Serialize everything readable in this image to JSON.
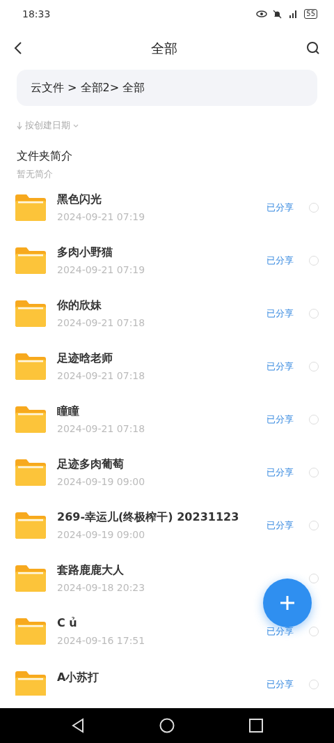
{
  "status_bar": {
    "time": "18:33",
    "battery": "55"
  },
  "header": {
    "title": "全部"
  },
  "breadcrumb": "云文件 > 全部2> 全部",
  "sort": {
    "label": "按创建日期"
  },
  "intro": {
    "title": "文件夹简介",
    "text": "暂无简介"
  },
  "folders": [
    {
      "name": "黑色闪光",
      "date": "2024-09-21 07:19",
      "share_status": "已分享",
      "selected": false
    },
    {
      "name": "多肉小野猫",
      "date": "2024-09-21 07:19",
      "share_status": "已分享",
      "selected": false
    },
    {
      "name": "你的欣妹",
      "date": "2024-09-21 07:18",
      "share_status": "已分享",
      "selected": false
    },
    {
      "name": "足迹晗老师",
      "date": "2024-09-21 07:18",
      "share_status": "已分享",
      "selected": false
    },
    {
      "name": "瞳瞳",
      "date": "2024-09-21 07:18",
      "share_status": "已分享",
      "selected": false
    },
    {
      "name": "足迹多肉葡萄",
      "date": "2024-09-19 09:00",
      "share_status": "已分享",
      "selected": false
    },
    {
      "name": "269-幸运儿(终极榨干) 20231123",
      "date": "2024-09-19 09:00",
      "share_status": "已分享",
      "selected": false
    },
    {
      "name": "套路鹿鹿大人",
      "date": "2024-09-18 20:23",
      "selected": false
    },
    {
      "name": "C ủ",
      "date": "2024-09-16 17:51",
      "share_status": "已分享",
      "selected": false
    },
    {
      "name": "A小苏打",
      "share_status": "已分享",
      "selected": false
    }
  ]
}
